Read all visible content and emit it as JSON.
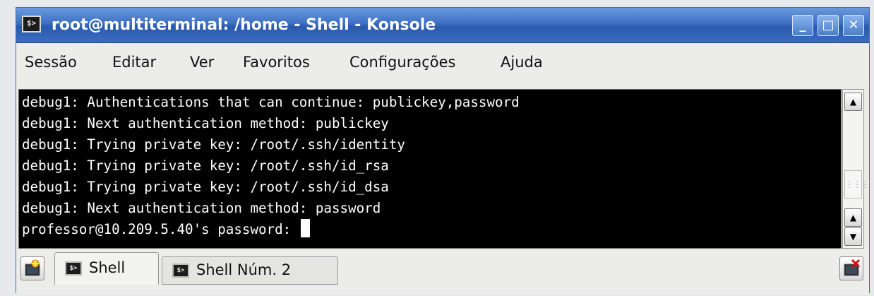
{
  "window": {
    "title": "root@multiterminal: /home - Shell - Konsole",
    "app_icon_glyph": "$>",
    "controls": {
      "minimize": "_",
      "maximize": "□",
      "close": "✕"
    }
  },
  "menu": {
    "items": [
      "Sessão",
      "Editar",
      "Ver",
      "Favoritos",
      "Configurações",
      "Ajuda"
    ]
  },
  "terminal": {
    "lines": [
      "debug1: Authentications that can continue: publickey,password",
      "debug1: Next authentication method: publickey",
      "debug1: Trying private key: /root/.ssh/identity",
      "debug1: Trying private key: /root/.ssh/id_rsa",
      "debug1: Trying private key: /root/.ssh/id_dsa",
      "debug1: Next authentication method: password",
      "professor@10.209.5.40's password: "
    ]
  },
  "scrollbar": {
    "up": "▲",
    "down": "▼",
    "grip": "⋮⋮⋮"
  },
  "tabs": {
    "items": [
      {
        "label": "Shell",
        "icon": "terminal-icon",
        "active": true
      },
      {
        "label": "Shell Núm. 2",
        "icon": "terminal-icon",
        "active": false
      }
    ],
    "new_session_icon": "new-session-icon",
    "close_session_icon": "close-session-icon"
  },
  "colors": {
    "titlebar": "#3d6fc4",
    "terminal_bg": "#000000",
    "terminal_fg": "#ffffff"
  }
}
